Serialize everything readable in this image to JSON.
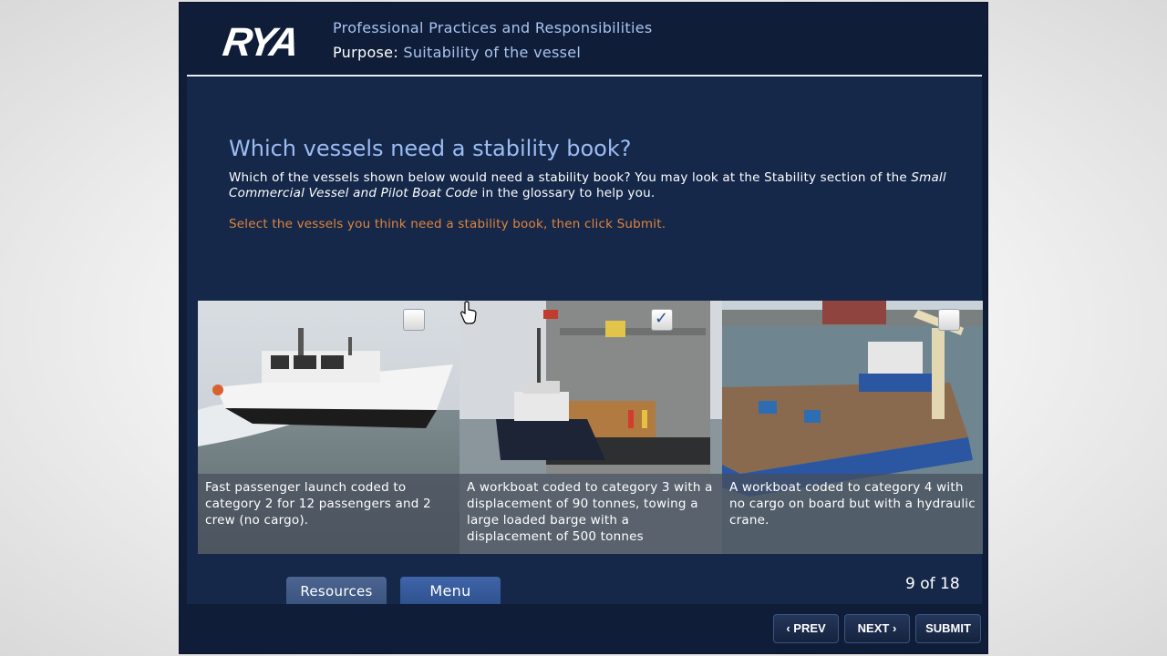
{
  "header": {
    "logo_text": "RYA",
    "course_title": "Professional Practices and Responsibilities",
    "purpose_label": "Purpose",
    "purpose_value": "Suitability of the vessel"
  },
  "question": {
    "title": "Which vessels need a stability book?",
    "text_before": "Which of the vessels shown below would need a stability book? You may look at the Stability section of the ",
    "text_italic": "Small Commercial Vessel and Pilot Boat Code",
    "text_after": " in the glossary to help you.",
    "instruction": "Select the vessels you think need a stability book, then click Submit."
  },
  "options": [
    {
      "caption": "Fast passenger launch coded to category 2 for 12 passengers and 2 crew (no cargo).",
      "checked": false
    },
    {
      "caption": "A workboat coded to category 3 with a displacement of 90 tonnes, towing a large loaded barge with a displacement of 500 tonnes",
      "checked": true
    },
    {
      "caption": "A workboat coded to category 4 with no cargo on board but with a hydraulic crane.",
      "checked": false
    }
  ],
  "tabs": {
    "resources": "Resources",
    "menu": "Menu"
  },
  "pager": "9 of 18",
  "nav": {
    "prev": "PREV",
    "next": "NEXT",
    "submit": "SUBMIT"
  },
  "colors": {
    "frame_bg": "#0f1d38",
    "panel_bg": "#15284a",
    "title_blue": "#9dbcf2",
    "instruction_orange": "#e0843a"
  }
}
